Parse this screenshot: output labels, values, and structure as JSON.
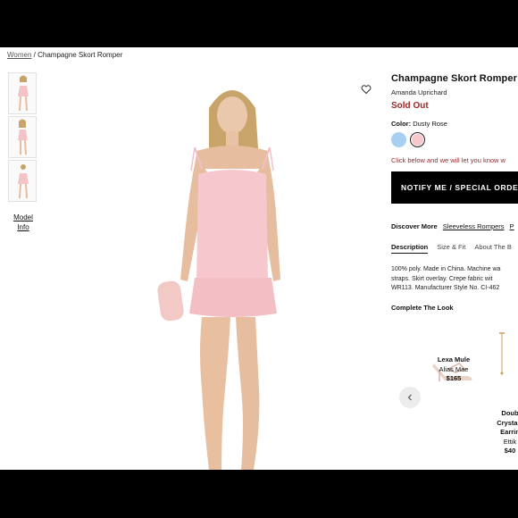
{
  "breadcrumb": {
    "parent": "Women",
    "separator": "/",
    "current": "Champagne Skort Romper"
  },
  "gallery": {
    "model_info": [
      "Model",
      "Info"
    ]
  },
  "product": {
    "title": "Champagne Skort Romper",
    "brand": "Amanda Uprichard",
    "status": "Sold Out",
    "color_label": "Color:",
    "color_value": "Dusty Rose",
    "swatches": [
      {
        "name": "blue",
        "color": "#a7d0f0"
      },
      {
        "name": "dusty rose",
        "color": "#f6c8cd"
      }
    ],
    "click_note": "Click below and we will let you know w",
    "notify_label": "NOTIFY ME / SPECIAL ORDE",
    "discover": {
      "label": "Discover More",
      "links": [
        "Sleeveless Rompers",
        "P"
      ]
    },
    "tabs": [
      "Description",
      "Size & Fit",
      "About The B"
    ],
    "description": [
      "100% poly. Made in China. Machine wa",
      "straps. Skirt overlay. Crepe fabric wit",
      "WR113. Manufacturer Style No. CI-462"
    ],
    "complete_look": "Complete The Look"
  },
  "look_items": [
    {
      "name": "Lexa Mule",
      "brand": "Alias Mae",
      "price": "$165"
    },
    {
      "name": "Doub",
      "name2": "Crystal I",
      "name3": "Earrin",
      "brand": "Ettik",
      "price": "$40"
    }
  ],
  "colors": {
    "sold_out": "#a0282a",
    "dress": "#f6c8cd",
    "button": "#000000"
  }
}
